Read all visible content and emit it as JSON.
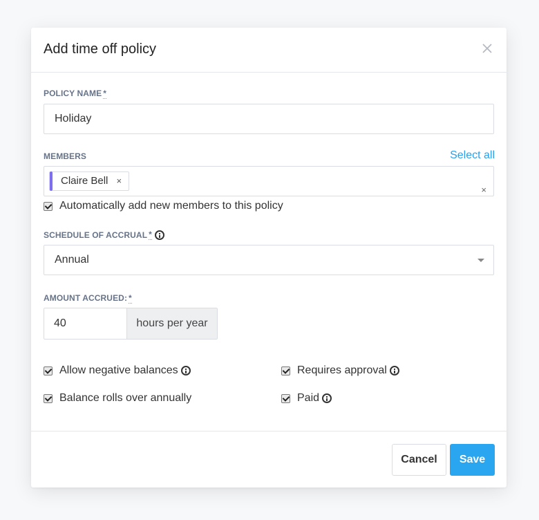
{
  "dialog": {
    "title": "Add time off policy",
    "close_icon": "close-icon"
  },
  "policy_name": {
    "label": "POLICY NAME",
    "required_marker": "*",
    "value": "Holiday"
  },
  "members": {
    "label": "MEMBERS",
    "select_all": "Select all",
    "chips": [
      {
        "name": "Claire Bell",
        "color": "#7d6ef0"
      }
    ],
    "chip_remove": "×",
    "clear": "×",
    "auto_add_label": "Automatically add new members to this policy",
    "auto_add_checked": true
  },
  "schedule": {
    "label": "SCHEDULE OF ACCRUAL",
    "required_marker": "*",
    "value": "Annual"
  },
  "amount": {
    "label": "AMOUNT ACCRUED:",
    "required_marker": "*",
    "value": "40",
    "suffix": "hours per year"
  },
  "options": [
    {
      "label": "Allow negative balances",
      "checked": true,
      "info": true
    },
    {
      "label": "Requires approval",
      "checked": true,
      "info": true
    },
    {
      "label": "Balance rolls over annually",
      "checked": true,
      "info": false
    },
    {
      "label": "Paid",
      "checked": true,
      "info": true
    }
  ],
  "footer": {
    "cancel_label": "Cancel",
    "save_label": "Save"
  },
  "colors": {
    "accent": "#2aa6f0",
    "link": "#2aa0ea",
    "chip_bar": "#7d6ef0",
    "label": "#667388"
  }
}
